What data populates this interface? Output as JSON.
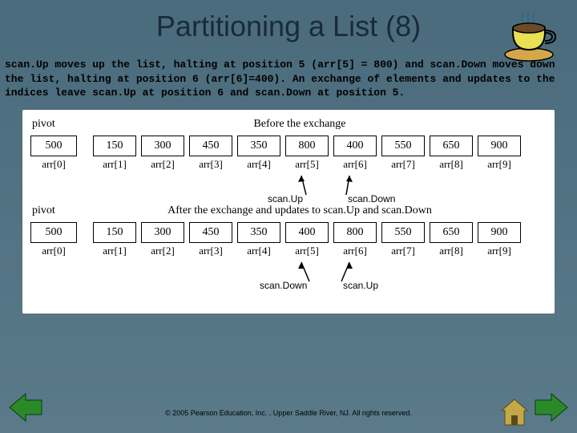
{
  "title": "Partitioning a List (8)",
  "body_text": "scan.Up moves up the list, halting at position 5 (arr[5] = 800) and scan.Down moves down the list, halting at position 6 (arr[6]=400). An exchange of elements and updates to the indices leave scan.Up at position 6 and scan.Down at position 5.",
  "diagram": {
    "pivot_label": "pivot",
    "caption_before": "Before the exchange",
    "caption_after": "After the exchange and updates to scan.Up and scan.Down",
    "pivot_value": "500",
    "before_values": [
      "150",
      "300",
      "450",
      "350",
      "800",
      "400",
      "550",
      "650",
      "900"
    ],
    "after_values": [
      "150",
      "300",
      "450",
      "350",
      "400",
      "800",
      "550",
      "650",
      "900"
    ],
    "indices": [
      "arr[0]",
      "arr[1]",
      "arr[2]",
      "arr[3]",
      "arr[4]",
      "arr[5]",
      "arr[6]",
      "arr[7]",
      "arr[8]",
      "arr[9]"
    ],
    "scanUp_label": "scan.Up",
    "scanDown_label": "scan.Down"
  },
  "footer": "© 2005 Pearson Education, Inc. , Upper Saddle River, NJ.  All rights reserved."
}
